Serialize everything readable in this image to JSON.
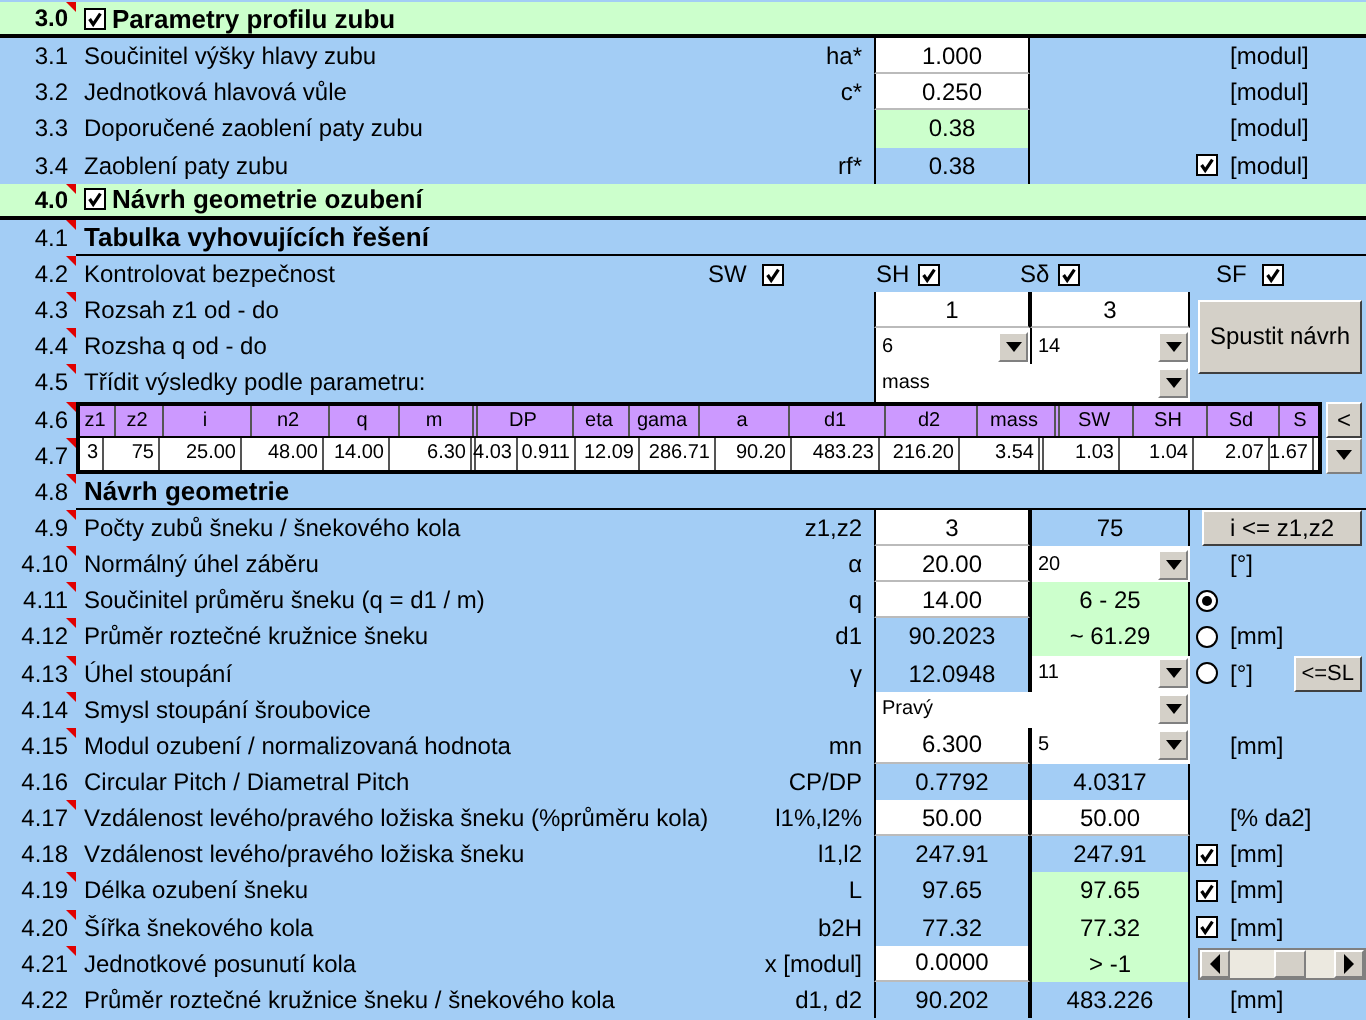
{
  "rows": [
    {
      "kind": "section",
      "number": "3.0",
      "note": true,
      "checked": true,
      "title": "Parametry profilu zubu"
    },
    {
      "kind": "param",
      "number": "3.1",
      "label": "Součinitel výšky hlavy zubu",
      "symbol": "ha*",
      "v1": {
        "text": "1.000",
        "kind": "input"
      },
      "unit": "[modul]"
    },
    {
      "kind": "param",
      "number": "3.2",
      "label": "Jednotková hlavová vůle",
      "symbol": "c*",
      "v1": {
        "text": "0.250",
        "kind": "input"
      },
      "unit": "[modul]"
    },
    {
      "kind": "param",
      "number": "3.3",
      "label": "Doporučené zaoblení paty zubu",
      "v1": {
        "text": "0.38",
        "kind": "green"
      },
      "unit": "[modul]"
    },
    {
      "kind": "param",
      "number": "3.4",
      "label": "Zaoblení paty zubu",
      "symbol": "rf*",
      "v1": {
        "text": "0.38",
        "kind": "calc"
      },
      "checked": true,
      "unit": "[modul]"
    },
    {
      "kind": "section",
      "number": "4.0",
      "note": true,
      "checked": true,
      "title": "Návrh geometrie ozubení"
    },
    {
      "kind": "subsection",
      "number": "4.1",
      "note": true,
      "title": "Tabulka vyhovujících řešení"
    },
    {
      "kind": "checks",
      "number": "4.2",
      "note": true,
      "label": "Kontrolovat bezpečnost",
      "checks": [
        {
          "label": "SW",
          "checked": true
        },
        {
          "label": "SH",
          "checked": true
        },
        {
          "label": "Sδ",
          "checked": true
        },
        {
          "label": "SF",
          "checked": true
        }
      ]
    },
    {
      "kind": "param",
      "number": "4.3",
      "note": true,
      "label": "Rozsah z1 od - do",
      "v1": {
        "text": "1",
        "kind": "input"
      },
      "v2": {
        "text": "3",
        "kind": "input"
      },
      "big_button": "Spustit návrh"
    },
    {
      "kind": "param",
      "number": "4.4",
      "note": true,
      "label": "Rozsha q od - do",
      "v1": {
        "text": "6",
        "kind": "dropdown"
      },
      "v2": {
        "text": "14",
        "kind": "dropdown"
      }
    },
    {
      "kind": "param",
      "number": "4.5",
      "note": true,
      "label": "Třídit výsledky podle parametru:",
      "select": "mass"
    },
    {
      "kind": "table-header",
      "number": "4.6",
      "note": true,
      "cells": [
        "z1",
        "z2",
        "i",
        "n2",
        "q",
        "m",
        "DP",
        "eta",
        "gama",
        "a",
        "d1",
        "d2",
        "mass",
        "SW",
        "SH",
        "Sd",
        "S"
      ],
      "side_button": "<"
    },
    {
      "kind": "table-values",
      "number": "4.7",
      "note": true,
      "cells": [
        "3",
        "75",
        "25.00",
        "48.00",
        "14.00",
        "6.30",
        "4.03",
        "0.911",
        "12.09",
        "286.71",
        "90.20",
        "483.23",
        "216.20",
        "3.54",
        "1.03",
        "1.04",
        "2.07",
        "1.67"
      ]
    },
    {
      "kind": "subsection",
      "number": "4.8",
      "note": true,
      "title": "Návrh geometrie"
    },
    {
      "kind": "param",
      "number": "4.9",
      "note": true,
      "label": "Počty zubů šneku / šnekového kola",
      "symbol": "z1,z2",
      "v1": {
        "text": "3",
        "kind": "input"
      },
      "v2": {
        "text": "75",
        "kind": "calc"
      },
      "wide_button": "i <= z1,z2"
    },
    {
      "kind": "param",
      "number": "4.10",
      "note": true,
      "label": "Normálný úhel záběru",
      "symbol": "α",
      "v1": {
        "text": "20.00",
        "kind": "input"
      },
      "v2": {
        "text": "20",
        "kind": "dropdown"
      },
      "unit": "[°]"
    },
    {
      "kind": "param",
      "number": "4.11",
      "note": true,
      "label": "Součinitel průměru šneku  (q = d1 / m)",
      "symbol": "q",
      "v1": {
        "text": "14.00",
        "kind": "input"
      },
      "v2": {
        "text": "6 - 25",
        "kind": "green"
      },
      "radio": {
        "selected": true
      }
    },
    {
      "kind": "param",
      "number": "4.12",
      "note": true,
      "label": "Průměr roztečné kružnice šneku",
      "symbol": "d1",
      "v1": {
        "text": "90.2023",
        "kind": "calc"
      },
      "v2": {
        "text": "~ 61.29",
        "kind": "green"
      },
      "radio": {
        "selected": false
      },
      "unit": "[mm]"
    },
    {
      "kind": "param",
      "number": "4.13",
      "note": true,
      "label": "Úhel stoupání",
      "symbol": "γ",
      "v1": {
        "text": "12.0948",
        "kind": "calc"
      },
      "v2": {
        "text": "11",
        "kind": "dropdown"
      },
      "radio": {
        "selected": false
      },
      "unit": "[°]",
      "small_button": "<=SL"
    },
    {
      "kind": "param",
      "number": "4.14",
      "note": true,
      "label": "Smysl stoupání šroubovice",
      "select": "Pravý"
    },
    {
      "kind": "param",
      "number": "4.15",
      "note": true,
      "label": "Modul ozubení / normalizovaná hodnota",
      "symbol": "mn",
      "v1": {
        "text": "6.300",
        "kind": "input"
      },
      "v2": {
        "text": "5",
        "kind": "dropdown"
      },
      "unit": "[mm]"
    },
    {
      "kind": "param",
      "number": "4.16",
      "label": "Circular Pitch / Diametral Pitch",
      "symbol": "CP/DP",
      "v1": {
        "text": "0.7792",
        "kind": "calc"
      },
      "v2": {
        "text": "4.0317",
        "kind": "calc"
      }
    },
    {
      "kind": "param",
      "number": "4.17",
      "note": true,
      "label": "Vzdálenost levého/pravého ložiska šneku (%průměru kola)",
      "symbol": "l1%,l2%",
      "v1": {
        "text": "50.00",
        "kind": "input"
      },
      "v2": {
        "text": "50.00",
        "kind": "input"
      },
      "unit": "[% da2]"
    },
    {
      "kind": "param",
      "number": "4.18",
      "label": "Vzdálenost levého/pravého ložiska šneku",
      "symbol": "l1,l2",
      "v1": {
        "text": "247.91",
        "kind": "calc"
      },
      "v2": {
        "text": "247.91",
        "kind": "calc"
      },
      "checked": true,
      "unit": "[mm]"
    },
    {
      "kind": "param",
      "number": "4.19",
      "note": true,
      "label": "Délka ozubení šneku",
      "symbol": "L",
      "v1": {
        "text": "97.65",
        "kind": "calc"
      },
      "v2": {
        "text": "97.65",
        "kind": "green"
      },
      "checked": true,
      "unit": "[mm]"
    },
    {
      "kind": "param",
      "number": "4.20",
      "note": true,
      "label": "Šířka šnekového kola",
      "symbol": "b2H",
      "v1": {
        "text": "77.32",
        "kind": "calc"
      },
      "v2": {
        "text": "77.32",
        "kind": "green"
      },
      "checked": true,
      "unit": "[mm]"
    },
    {
      "kind": "scroll-param",
      "number": "4.21",
      "note": true,
      "label": "Jednotkové posunutí kola",
      "symbol": "x [modul]",
      "v1": {
        "text": "0.0000",
        "kind": "input"
      },
      "v2": {
        "text": "> -1",
        "kind": "green"
      }
    },
    {
      "kind": "param",
      "number": "4.22",
      "label": "Průměr roztečné kružnice šneku / šnekového kola",
      "symbol": "d1, d2",
      "v1": {
        "text": "90.202",
        "kind": "calc"
      },
      "v2": {
        "text": "483.226",
        "kind": "calc"
      },
      "unit": "[mm]"
    }
  ]
}
